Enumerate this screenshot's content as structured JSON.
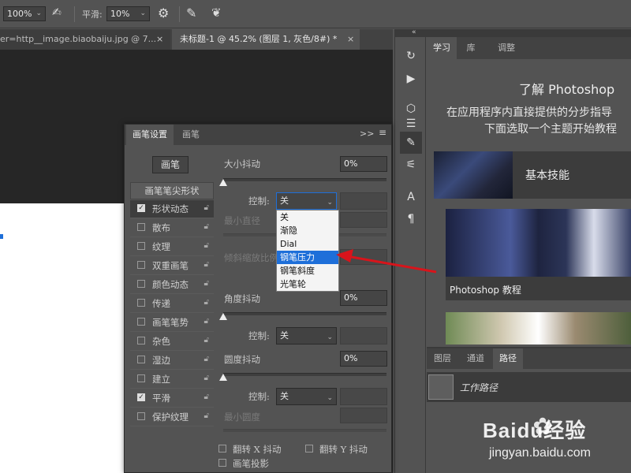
{
  "optionsbar": {
    "zoom": "100%",
    "smoothing_label": "平滑:",
    "smoothing_value": "10%"
  },
  "doc_tabs": [
    {
      "label": "er=http__image.biaobaiju.jpg @ 7...",
      "close": "×"
    },
    {
      "label": "未标题-1 @ 45.2% (图层 1, 灰色/8#) *",
      "close": "×"
    }
  ],
  "brush_panel": {
    "tabs": [
      "画笔设置",
      "画笔"
    ],
    "menu_icons": [
      ">>",
      "≡"
    ],
    "brush_button": "画笔",
    "tip_shape_header": "画笔笔尖形状",
    "items": [
      {
        "label": "形状动态",
        "checked": true,
        "selected": true
      },
      {
        "label": "散布",
        "checked": false
      },
      {
        "label": "纹理",
        "checked": false
      },
      {
        "label": "双重画笔",
        "checked": false
      },
      {
        "label": "颜色动态",
        "checked": false
      },
      {
        "label": "传递",
        "checked": false
      },
      {
        "label": "画笔笔势",
        "checked": false
      },
      {
        "label": "杂色",
        "checked": false
      },
      {
        "label": "湿边",
        "checked": false
      },
      {
        "label": "建立",
        "checked": false
      },
      {
        "label": "平滑",
        "checked": true
      },
      {
        "label": "保护纹理",
        "checked": false
      }
    ],
    "size_jitter_label": "大小抖动",
    "size_jitter_value": "0%",
    "control_label": "控制:",
    "control_value": "关",
    "min_diameter_label": "最小直径",
    "tilt_scale_label": "倾斜缩放比例",
    "angle_jitter_label": "角度抖动",
    "angle_jitter_value": "0%",
    "angle_control_value": "关",
    "roundness_jitter_label": "圆度抖动",
    "roundness_jitter_value": "0%",
    "roundness_control_value": "关",
    "min_roundness_label": "最小圆度",
    "flip_x_label": "翻转 X 抖动",
    "flip_y_label": "翻转 Y 抖动",
    "brush_projection_label": "画笔投影",
    "dropdown_options": [
      "关",
      "渐隐",
      "Dial",
      "钢笔压力",
      "钢笔斜度",
      "光笔轮"
    ],
    "dropdown_highlighted": "钢笔压力"
  },
  "learn_panel": {
    "tabs": [
      "学习",
      "库",
      "调整"
    ],
    "title": "了解 Photoshop",
    "desc_line1": "在应用程序内直接提供的分步指导",
    "desc_line2": "下面选取一个主题开始教程",
    "card1_label": "基本技能",
    "card2_label": "Photoshop 教程"
  },
  "layers_panel": {
    "tabs": [
      "图层",
      "通道",
      "路径"
    ],
    "path_item": "工作路径"
  },
  "watermark": {
    "brand": "Baidu经验",
    "url": "jingyan.baidu.com"
  },
  "colors": {
    "highlight": "#1e6fd9",
    "arrow": "#d8141b",
    "panel_bg": "#535353",
    "dark_bg": "#323232"
  }
}
